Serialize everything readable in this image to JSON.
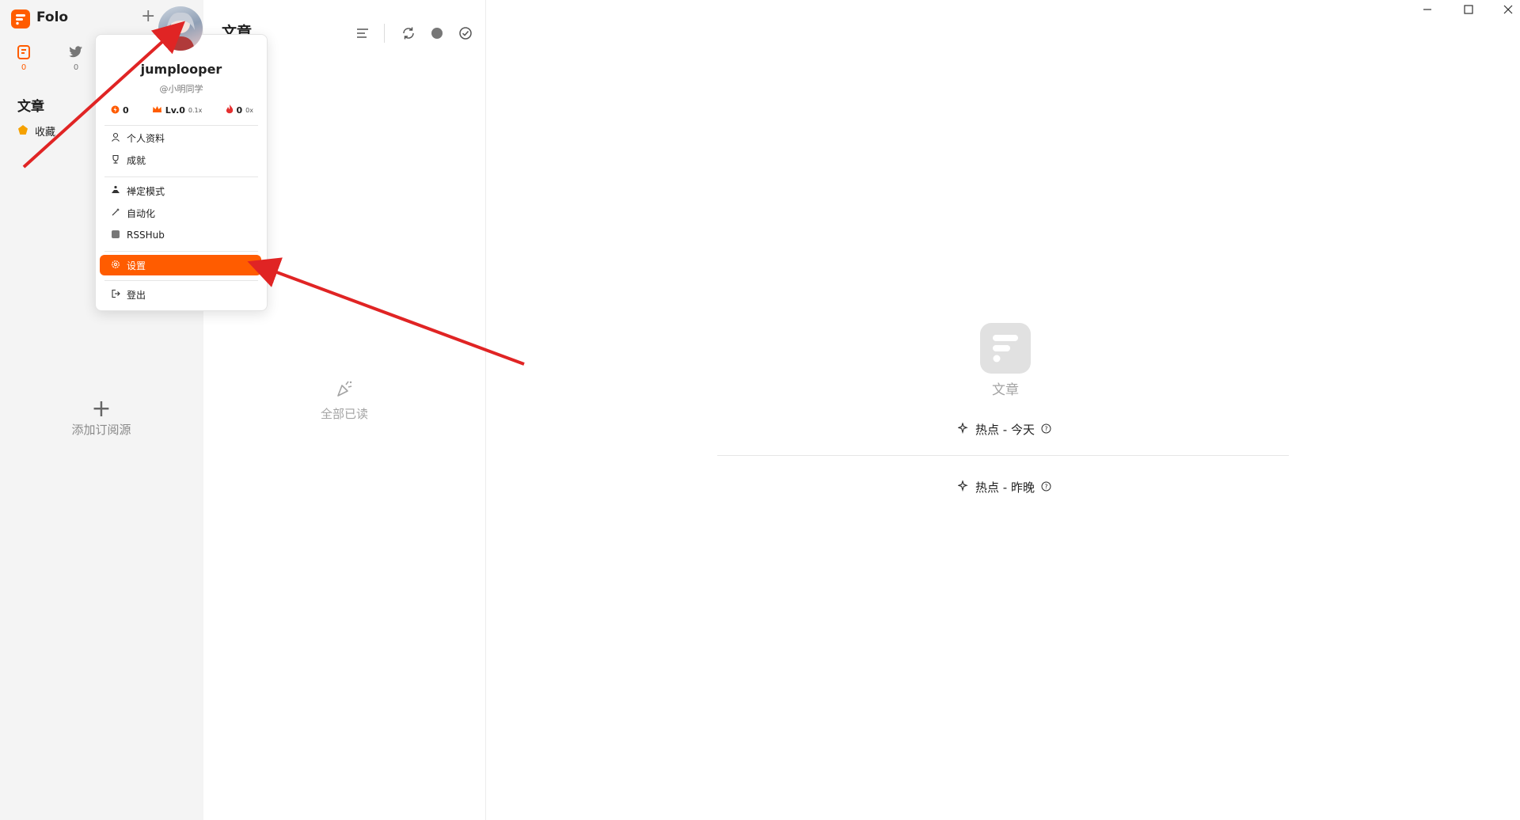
{
  "app": {
    "name": "Folo"
  },
  "sidebar": {
    "views": [
      {
        "icon": "article-icon",
        "count": "0",
        "color": "#ff5c00"
      },
      {
        "icon": "bird-icon",
        "count": "0",
        "color": "#777777"
      }
    ],
    "section_title": "文章",
    "favorites_label": "收藏",
    "add_subscription_label": "添加订阅源"
  },
  "entry_column": {
    "title": "文章",
    "all_read_label": "全部已读"
  },
  "main": {
    "label": "文章",
    "hot_today": "热点 - 今天",
    "hot_yesterday": "热点 - 昨晚"
  },
  "user_menu": {
    "username": "jumplooper",
    "handle": "@小明同学",
    "stats": {
      "power": "0",
      "level": "Lv.0",
      "level_mult": "0.1x",
      "streak": "0",
      "streak_mult": "0x"
    },
    "items_group1": [
      "个人资料",
      "成就"
    ],
    "items_group2": [
      "禅定模式",
      "自动化",
      "RSSHub"
    ],
    "settings_label": "设置",
    "logout_label": "登出"
  },
  "colors": {
    "accent": "#ff5c00",
    "arrow": "#e02424"
  }
}
